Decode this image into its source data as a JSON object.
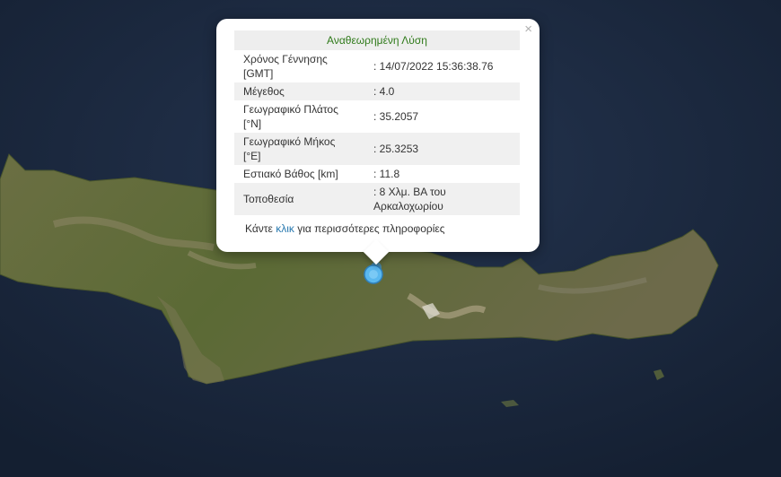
{
  "map": {
    "colors": {
      "sea": "#1f2d44",
      "land": "#5f6a3b",
      "mountain": "#9b9073",
      "marker": "#5ab8ef"
    }
  },
  "popup": {
    "title": "Αναθεωρημένη Λύση",
    "close_symbol": "×",
    "rows": [
      {
        "label": "Χρόνος Γέννησης [GMT]",
        "value": ": 14/07/2022 15:36:38.76"
      },
      {
        "label": "Μέγεθος",
        "value": ": 4.0"
      },
      {
        "label": "Γεωγραφικό Πλάτος [°N]",
        "value": ": 35.2057"
      },
      {
        "label": "Γεωγραφικό Μήκος [°E]",
        "value": ": 25.3253"
      },
      {
        "label": "Εστιακό Βάθος [km]",
        "value": ": 11.8"
      },
      {
        "label": "Τοποθεσία",
        "value": ": 8 Χλμ. ΒΑ του Αρκαλοχωρίου"
      }
    ],
    "more_prefix": "Κάντε ",
    "more_link": "κλικ",
    "more_suffix": " για περισσότερες πληροφορίες"
  }
}
